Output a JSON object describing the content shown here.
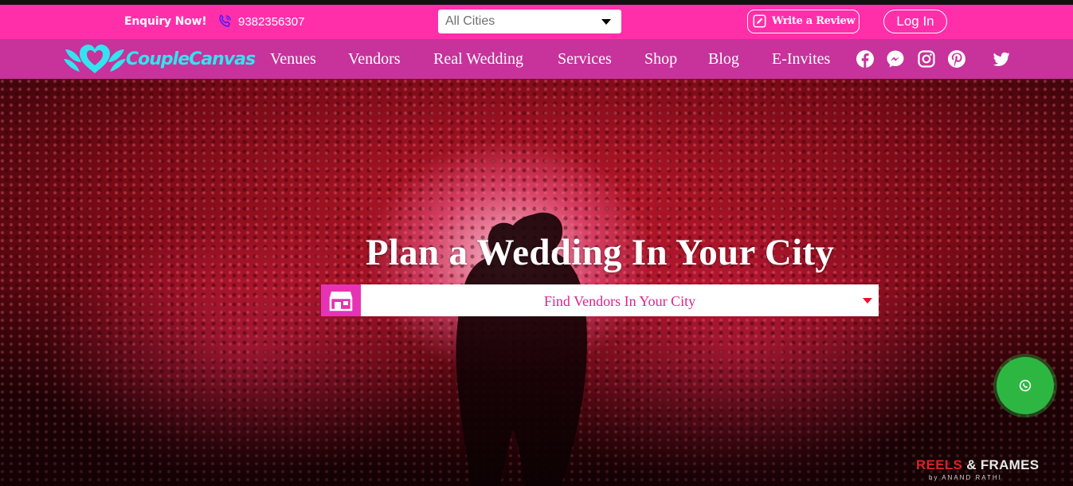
{
  "topbar": {
    "enquiry_label": "Enquiry Now!",
    "phone_icon": "phone-icon",
    "phone_number": "9382356307",
    "city_select_value": "All Cities",
    "review_label": "Write a Review",
    "review_icon": "pencil-square-icon",
    "login_label": "Log In",
    "bg_color": "#ff2fa9"
  },
  "navbar": {
    "bg_color": "#c7329b",
    "logo_text": "CoupleCanvas",
    "logo_icon": "hearts-wings-icon",
    "items": [
      {
        "label": "Venues"
      },
      {
        "label": "Vendors"
      },
      {
        "label": "Real Wedding"
      },
      {
        "label": "Services"
      },
      {
        "label": "Shop"
      },
      {
        "label": "Blog"
      },
      {
        "label": "E-Invites"
      }
    ],
    "social": [
      "facebook-icon",
      "messenger-icon",
      "instagram-icon",
      "pinterest-icon",
      "twitter-icon"
    ]
  },
  "hero": {
    "title": "Plan a Wedding In Your City",
    "search_label": "Find Vendors In Your City",
    "search_icon": "store-icon",
    "accent_color": "#e633b4"
  },
  "whatsapp": {
    "icon": "whatsapp-icon",
    "color": "#2db742"
  },
  "watermark": {
    "line1_a": "REELS",
    "line1_b": "& FRAMES",
    "line2": "by ANAND RATHI"
  }
}
